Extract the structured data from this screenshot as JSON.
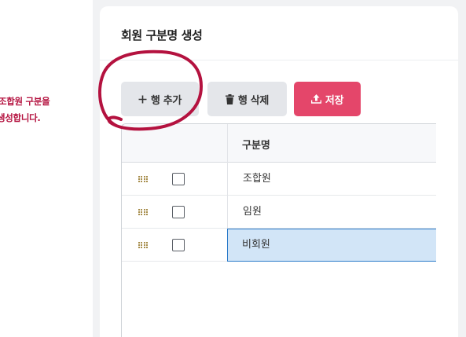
{
  "annotation": {
    "line1": "조합원 구분을",
    "line2": "생성합니다."
  },
  "card": {
    "title": "회원 구분명 생성"
  },
  "toolbar": {
    "add_label": "행 추가",
    "delete_label": "행 삭제",
    "save_label": "저장"
  },
  "grid": {
    "column_header": "구분명",
    "rows": [
      {
        "name": "조합원",
        "checked": false,
        "selected": false
      },
      {
        "name": "임원",
        "checked": false,
        "selected": false
      },
      {
        "name": "비회원",
        "checked": false,
        "selected": true
      }
    ]
  },
  "icons": {
    "add": "plus-icon",
    "delete": "trash-icon",
    "save": "upload-icon",
    "drag": "drag-handle-icon"
  },
  "colors": {
    "accent": "#e4466a",
    "annotation": "#b4123f",
    "scribble": "#b4123f",
    "selected_cell": "#d2e5f7",
    "selected_border": "#2b7ac9"
  }
}
